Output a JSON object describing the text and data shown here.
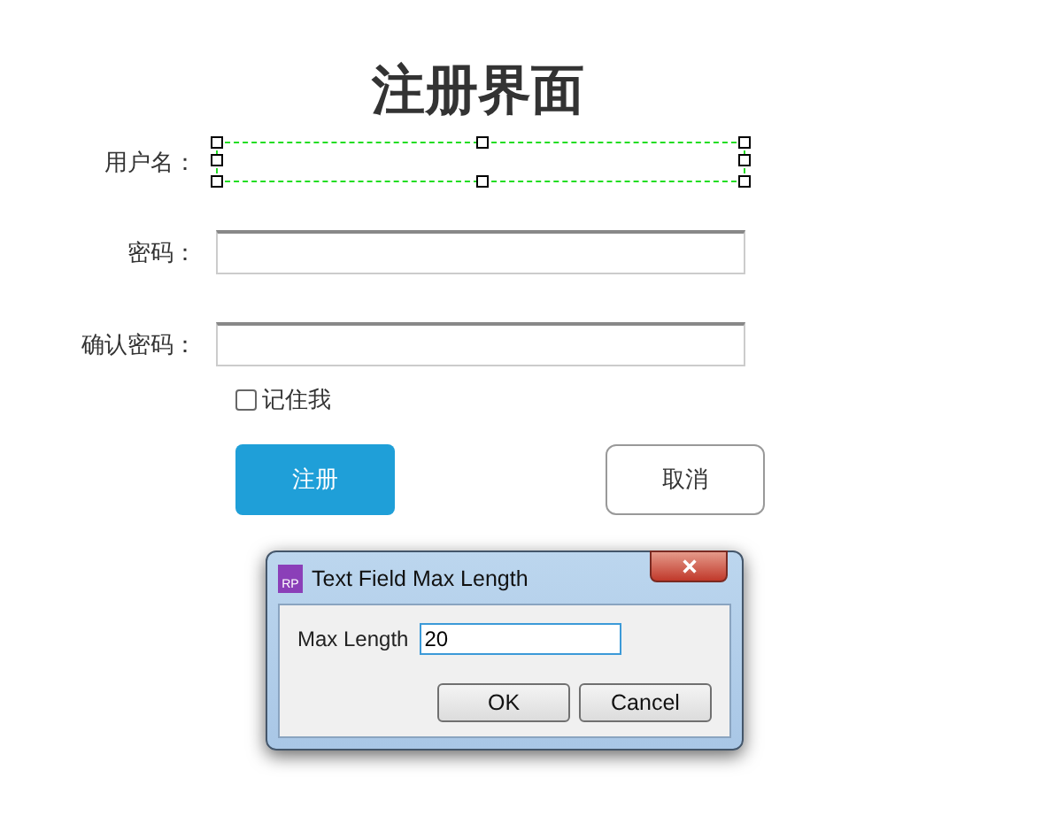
{
  "title": "注册界面",
  "fields": [
    {
      "label": "用户名：",
      "selected": true
    },
    {
      "label": "密码：",
      "selected": false
    },
    {
      "label": "确认密码：",
      "selected": false
    }
  ],
  "remember": {
    "label": "记住我",
    "checked": false
  },
  "buttons": [
    {
      "label": "注册",
      "kind": "primary"
    },
    {
      "label": "取消",
      "kind": "secondary"
    }
  ],
  "dialog": {
    "app_icon_text": "RP",
    "title": "Text Field Max Length",
    "field_label": "Max Length",
    "field_value": "20",
    "buttons": [
      "OK",
      "Cancel"
    ]
  }
}
